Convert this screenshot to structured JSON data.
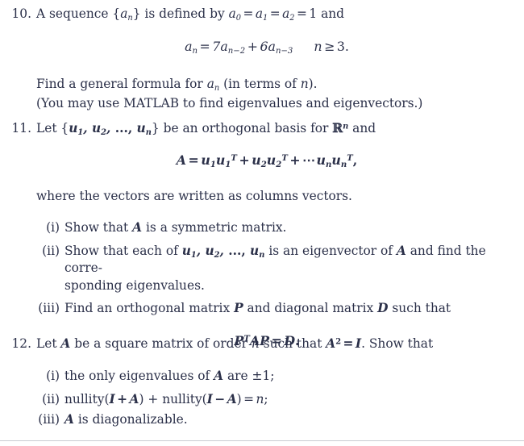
{
  "document": {
    "ink_color": "#2b3049",
    "background_color": "#ffffff",
    "divider_color": "#c9ccd2"
  },
  "problems": [
    {
      "number": "10.",
      "stem_prefix": "A sequence {",
      "stem_var": "a",
      "stem_var_sub": "n",
      "stem_mid": "} is defined by ",
      "stem_initial_conditions": "a₀ = a₁ = a₂ = 1",
      "stem_suffix": " and",
      "display_equation": "aₙ = 7aₙ₋₂ + 6aₙ₋₃",
      "display_condition": "n ≥ 3.",
      "line_find_formula": "Find a general formula for aₙ (in terms of n).",
      "line_matlab_note": "(You may use MATLAB to find eigenvalues and eigenvectors.)"
    },
    {
      "number": "11.",
      "stem_text": "Let {u₁, u₂, ..., uₙ} be an orthogonal basis for ℝⁿ and",
      "display_equation": "A = u₁u₁ᵀ + u₂u₂ᵀ + ⋯ uₙuₙᵀ,",
      "line_where": "where the vectors are written as columns vectors.",
      "subitems": [
        {
          "label": "(i)",
          "text": "Show that A is a symmetric matrix."
        },
        {
          "label": "(ii)",
          "text": "Show that each of u₁, u₂, ..., uₙ is an eigenvector of A and find the corresponding eigenvalues.",
          "line1": "Show that each of u₁, u₂, ..., uₙ is an eigenvector of A and find the corre-",
          "line2": "sponding eigenvalues."
        },
        {
          "label": "(iii)",
          "text": "Find an orthogonal matrix P and diagonal matrix D such that",
          "display_equation": "PᵀAP = D."
        }
      ]
    },
    {
      "number": "12.",
      "stem_text": "Let A be a square matrix of order n such that A² = I. Show that",
      "subitems": [
        {
          "label": "(i)",
          "text": "the only eigenvalues of A are ±1;"
        },
        {
          "label": "(ii)",
          "text": "nullity(I + A) + nullity(I − A) = n;"
        },
        {
          "label": "(iii)",
          "text": "A is diagonalizable."
        }
      ]
    }
  ]
}
